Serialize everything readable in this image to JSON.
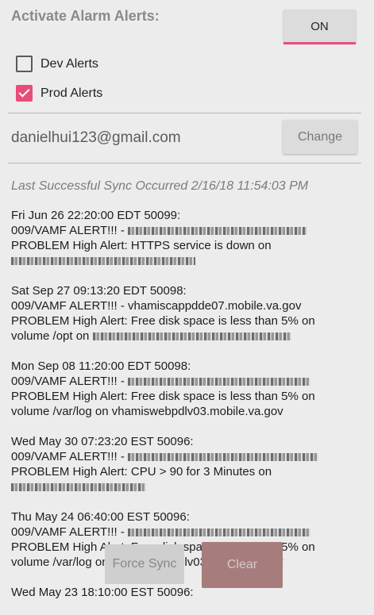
{
  "header": {
    "title": "Activate Alarm Alerts:",
    "toggle_label": "ON"
  },
  "options": {
    "dev_label": "Dev Alerts",
    "dev_checked": false,
    "prod_label": "Prod Alerts",
    "prod_checked": true
  },
  "account": {
    "email": "danielhui123@gmail.com",
    "change_label": "Change"
  },
  "sync": {
    "status": "Last Successful Sync Occurred 2/16/18 11:54:03 PM"
  },
  "alerts": [
    {
      "l1": "Fri Jun 26 22:20:00 EDT 50099:",
      "l2": "009/VAMF ALERT!!! - ",
      "l3": "PROBLEM High Alert: HTTPS service is down on",
      "l4": ""
    },
    {
      "l1": "Sat Sep 27 09:13:20 EDT 50098:",
      "l2": "009/VAMF ALERT!!! - vhamiscappdde07.mobile.va.gov",
      "l3": "PROBLEM High Alert: Free disk space is less than 5% on",
      "l4": "volume /opt on "
    },
    {
      "l1": "Mon Sep 08 11:20:00 EDT 50098:",
      "l2": "009/VAMF ALERT!!! - ",
      "l3": "PROBLEM High Alert: Free disk space is less than 5% on",
      "l4": "volume /var/log on vhamiswebpdlv03.mobile.va.gov"
    },
    {
      "l1": "Wed May 30 07:23:20 EST 50096:",
      "l2": "009/VAMF ALERT!!! - ",
      "l3": "PROBLEM High Alert: CPU > 90 for 3 Minutes on",
      "l4": ""
    },
    {
      "l1": "Thu May 24 06:40:00 EST 50096:",
      "l2": "009/VAMF ALERT!!! - ",
      "l3": "PROBLEM High Alert: Free disk space is less than 5% on",
      "l4": "volume /var/log on vhamiswebpdlv03.mobile.va.gov"
    },
    {
      "l1": "Wed May 23 18:10:00 EST 50096:",
      "l2": "",
      "l3": "",
      "l4": ""
    }
  ],
  "footer": {
    "force_sync_label": "Force Sync",
    "clear_label": "Clear"
  },
  "colors": {
    "accent": "#e84d7a",
    "background": "#ececec"
  }
}
